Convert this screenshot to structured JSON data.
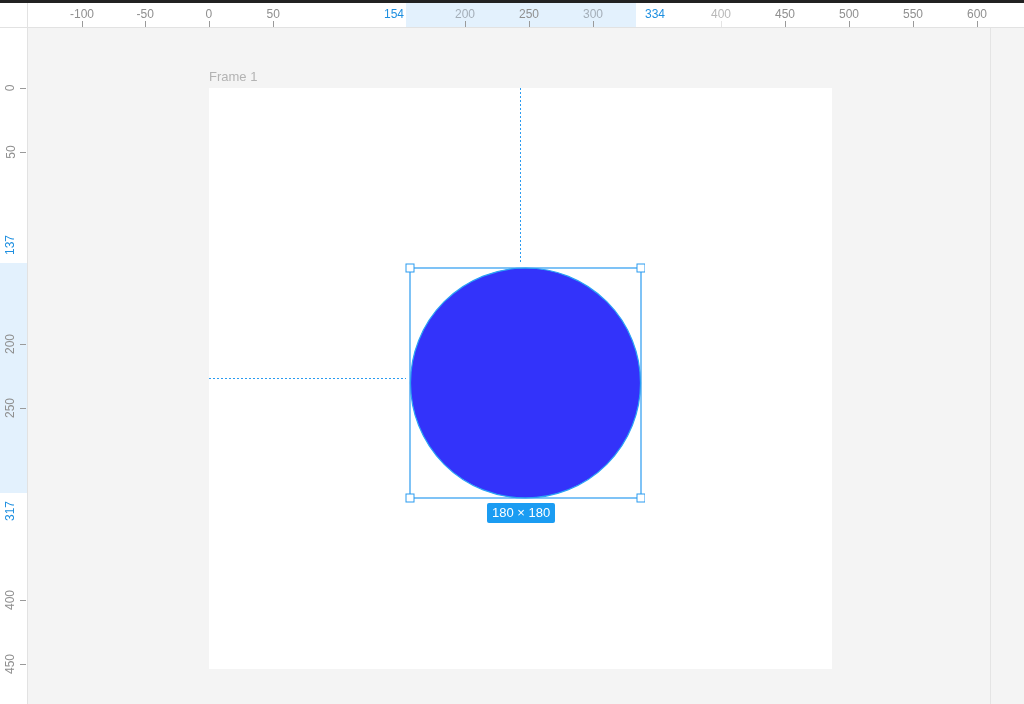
{
  "top_ruler": {
    "labels": [
      {
        "text": "-100",
        "kind": "tick"
      },
      {
        "text": "-50",
        "kind": "tick"
      },
      {
        "text": "0",
        "kind": "tick"
      },
      {
        "text": "50",
        "kind": "tick"
      },
      {
        "text": "154",
        "kind": "bound"
      },
      {
        "text": "200",
        "kind": "muted"
      },
      {
        "text": "250",
        "kind": "tick"
      },
      {
        "text": "300",
        "kind": "muted"
      },
      {
        "text": "334",
        "kind": "bound"
      },
      {
        "text": "400",
        "kind": "faint"
      },
      {
        "text": "450",
        "kind": "tick"
      },
      {
        "text": "500",
        "kind": "tick"
      },
      {
        "text": "550",
        "kind": "tick"
      },
      {
        "text": "600",
        "kind": "tick"
      }
    ]
  },
  "left_ruler": {
    "labels": [
      {
        "text": "0",
        "kind": "tick"
      },
      {
        "text": "50",
        "kind": "tick"
      },
      {
        "text": "137",
        "kind": "bound"
      },
      {
        "text": "200",
        "kind": "tick"
      },
      {
        "text": "250",
        "kind": "tick"
      },
      {
        "text": "317",
        "kind": "bound"
      },
      {
        "text": "400",
        "kind": "tick"
      },
      {
        "text": "450",
        "kind": "tick"
      }
    ]
  },
  "canvas": {
    "frame": {
      "title": "Frame 1"
    },
    "selection": {
      "size": "180 × 180"
    }
  }
}
